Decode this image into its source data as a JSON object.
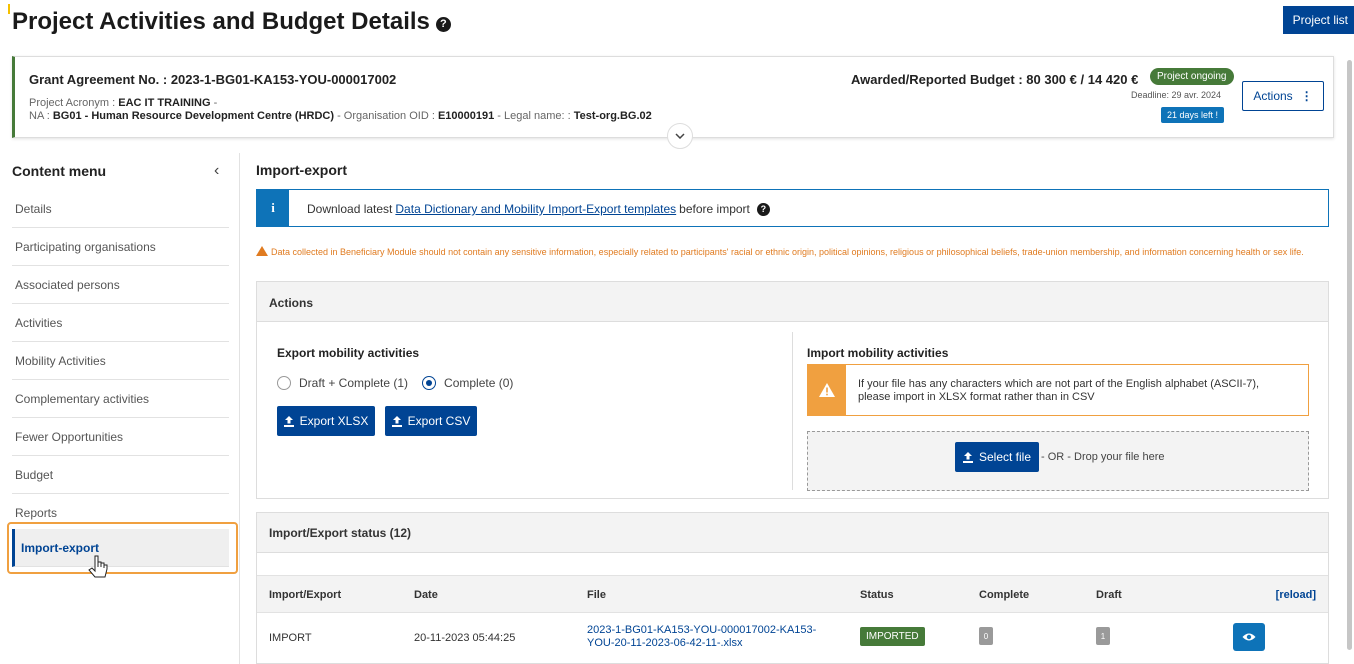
{
  "page": {
    "title": "Project Activities and Budget Details",
    "project_list_label": "Project list"
  },
  "grant": {
    "number_label": "Grant Agreement No. : 2023-1-BG01-KA153-YOU-000017002",
    "acronym_label": "Project Acronym : ",
    "acronym_value": "EAC IT TRAINING",
    "acronym_suffix": " -",
    "na_label": "NA : ",
    "na_value": "BG01 - Human Resource Development Centre (HRDC)",
    "oid_label": " - Organisation OID : ",
    "oid_value": "E10000191",
    "legal_label": " - Legal name: : ",
    "legal_value": "Test-org.BG.02",
    "budget_label": "Awarded/Reported Budget : 80 300 € / 14 420 €",
    "status_badge": "Project ongoing",
    "deadline": "Deadline: 29 avr. 2024",
    "days_left": "21 days left !",
    "actions_label": "Actions"
  },
  "sidebar": {
    "header": "Content menu",
    "items": [
      {
        "label": "Details"
      },
      {
        "label": "Participating organisations"
      },
      {
        "label": "Associated persons"
      },
      {
        "label": "Activities"
      },
      {
        "label": "Mobility Activities"
      },
      {
        "label": "Complementary activities"
      },
      {
        "label": "Fewer Opportunities"
      },
      {
        "label": "Budget"
      },
      {
        "label": "Reports"
      },
      {
        "label": "Import-export"
      }
    ]
  },
  "main": {
    "title": "Import-export",
    "info": {
      "before": "Download latest ",
      "link": "Data Dictionary and Mobility Import-Export templates",
      "after": " before import"
    },
    "warning": "Data collected in Beneficiary Module should not contain any sensitive information, especially related to participants' racial or ethnic origin, political opinions, religious or philosophical beliefs, trade-union membership, and information concerning health or sex life.",
    "actions_panel": {
      "header": "Actions",
      "export_title": "Export mobility activities",
      "radio_draft": "Draft + Complete (1)",
      "radio_complete": "Complete (0)",
      "export_xlsx": "Export XLSX",
      "export_csv": "Export CSV",
      "import_title": "Import mobility activities",
      "ascii_warning_line1": "If your file has any characters which are not part of the English alphabet (ASCII-7),",
      "ascii_warning_line2": "please import in XLSX format rather than in CSV",
      "select_file": "Select file",
      "drop_text": "- OR - Drop your file here"
    },
    "status_panel": {
      "header": "Import/Export status (12)",
      "columns": [
        "Import/Export",
        "Date",
        "File",
        "Status",
        "Complete",
        "Draft"
      ],
      "reload": "[reload]",
      "rows": [
        {
          "type": "IMPORT",
          "date": "20-11-2023 05:44:25",
          "file_line1": "2023-1-BG01-KA153-YOU-000017002-KA153-",
          "file_line2": "YOU-20-11-2023-06-42-11-.xlsx",
          "status": "IMPORTED",
          "complete": "0",
          "draft": "1"
        }
      ]
    }
  },
  "colors": {
    "primary": "#004494",
    "info": "#0e73b8",
    "success": "#467a39",
    "warning": "#e07b20",
    "highlight": "#f0a040"
  }
}
